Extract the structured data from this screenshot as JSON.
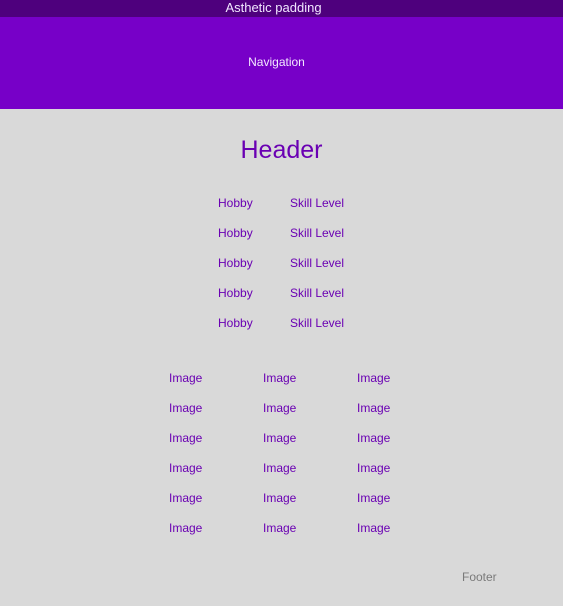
{
  "top_strip": {
    "label": "Asthetic padding"
  },
  "nav": {
    "label": "Navigation"
  },
  "header": {
    "title": "Header"
  },
  "hobbies": [
    {
      "hobby": "Hobby",
      "skill": "Skill Level"
    },
    {
      "hobby": "Hobby",
      "skill": "Skill Level"
    },
    {
      "hobby": "Hobby",
      "skill": "Skill Level"
    },
    {
      "hobby": "Hobby",
      "skill": "Skill Level"
    },
    {
      "hobby": "Hobby",
      "skill": "Skill Level"
    }
  ],
  "images": [
    [
      "Image",
      "Image",
      "Image"
    ],
    [
      "Image",
      "Image",
      "Image"
    ],
    [
      "Image",
      "Image",
      "Image"
    ],
    [
      "Image",
      "Image",
      "Image"
    ],
    [
      "Image",
      "Image",
      "Image"
    ],
    [
      "Image",
      "Image",
      "Image"
    ]
  ],
  "footer": {
    "label": "Footer"
  },
  "colors": {
    "background": "#d9d9d9",
    "top_strip": "#4e007d",
    "nav": "#7700c8",
    "accent_text": "#6a00b3",
    "footer_text": "#7a7a7a"
  }
}
